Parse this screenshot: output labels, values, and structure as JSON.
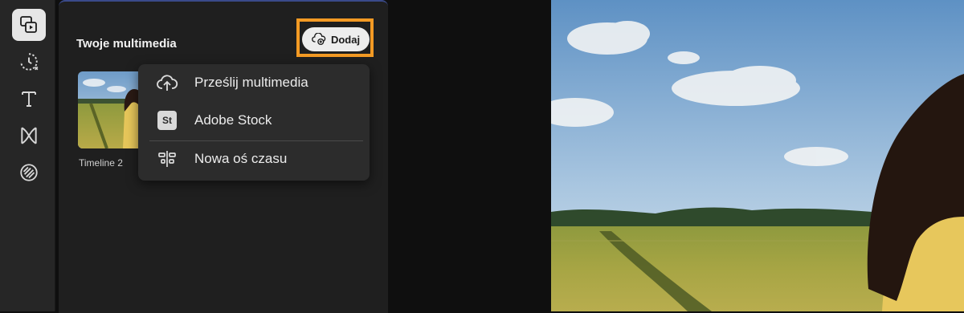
{
  "sidebar": {
    "items": [
      {
        "icon": "media-icon",
        "active": true
      },
      {
        "icon": "transitions-icon",
        "active": false
      },
      {
        "icon": "text-icon",
        "active": false
      },
      {
        "icon": "effects-icon",
        "active": false
      },
      {
        "icon": "stickers-icon",
        "active": false
      }
    ]
  },
  "panel": {
    "title": "Twoje multimedia",
    "add_button_label": "Dodaj",
    "highlight_color": "#f39a24"
  },
  "media": {
    "items": [
      {
        "label": "Timeline 2"
      }
    ]
  },
  "add_menu": {
    "items": [
      {
        "icon": "cloud-upload-icon",
        "label": "Prześlij multimedia"
      },
      {
        "icon": "adobe-stock-icon",
        "badge": "St",
        "label": "Adobe Stock"
      },
      {
        "icon": "new-timeline-icon",
        "label": "Nowa oś czasu"
      }
    ]
  }
}
